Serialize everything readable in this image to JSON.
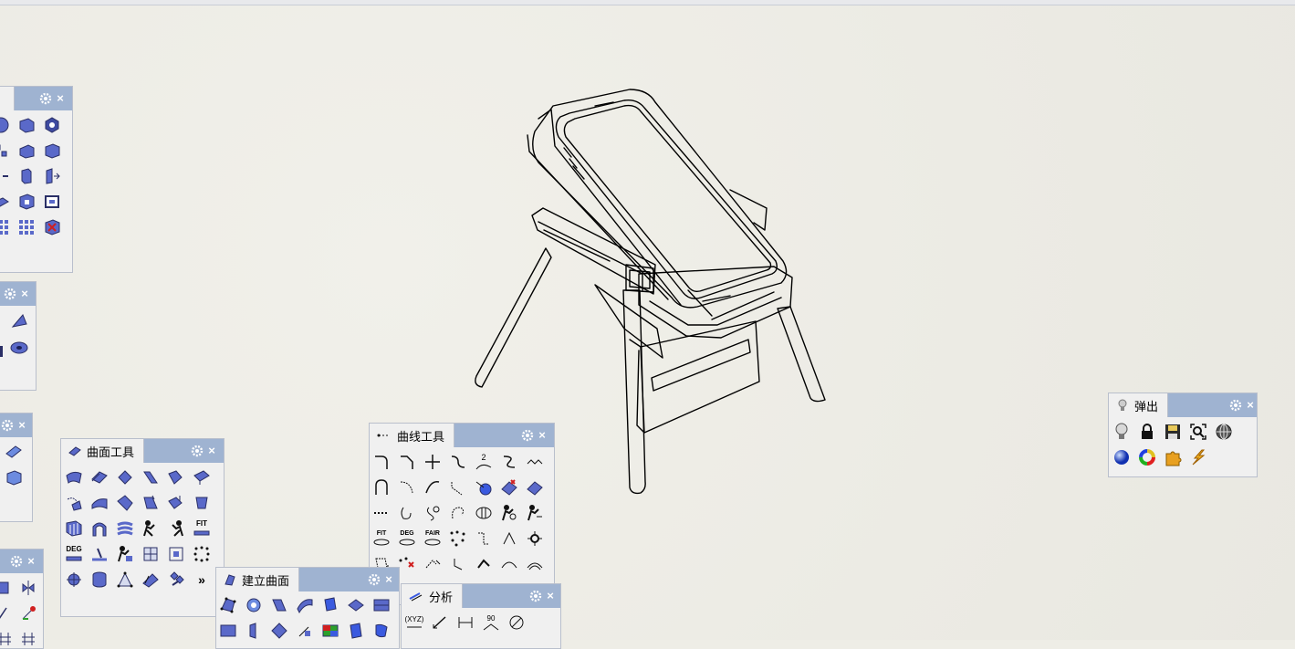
{
  "panels": {
    "popup": {
      "title": "弹出"
    },
    "surface_tools": {
      "title": "曲面工具",
      "more": "»"
    },
    "curve_tools": {
      "title": "曲线工具"
    },
    "build_surface": {
      "title": "建立曲面"
    },
    "analysis": {
      "title": "分析"
    }
  },
  "icon_text": {
    "fit": "FIT",
    "deg": "DEG",
    "fair": "FAIR",
    "xyz": "(XYZ)",
    "two": "2",
    "ninety": "90"
  },
  "colors": {
    "panel_header": "#9fb3d1",
    "panel_bg": "#f0f0f0",
    "icon_blue": "#5a69c9",
    "icon_dark": "#2a2f66"
  }
}
